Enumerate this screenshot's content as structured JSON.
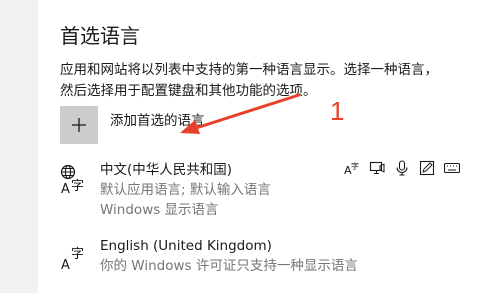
{
  "section": {
    "title": "首选语言",
    "description": "应用和网站将以列表中支持的第一种语言显示。选择一种语言，然后选择用于配置键盘和其他功能的选项。"
  },
  "add_language": {
    "label": "添加首选的语言",
    "icon": "plus-icon"
  },
  "languages": [
    {
      "name": "中文(中华人民共和国)",
      "subtitles": [
        "默认应用语言; 默认输入语言",
        "Windows 显示语言"
      ],
      "icon": "language-globe-icon",
      "features": [
        "text-to-speech-icon",
        "display-language-icon",
        "speech-icon",
        "handwriting-icon",
        "keyboard-icon"
      ]
    },
    {
      "name": "English (United Kingdom)",
      "subtitles": [
        "你的 Windows 许可证只支持一种显示语言"
      ],
      "icon": "language-icon"
    }
  ],
  "annotation": {
    "number": "1",
    "color": "#e8402a"
  }
}
